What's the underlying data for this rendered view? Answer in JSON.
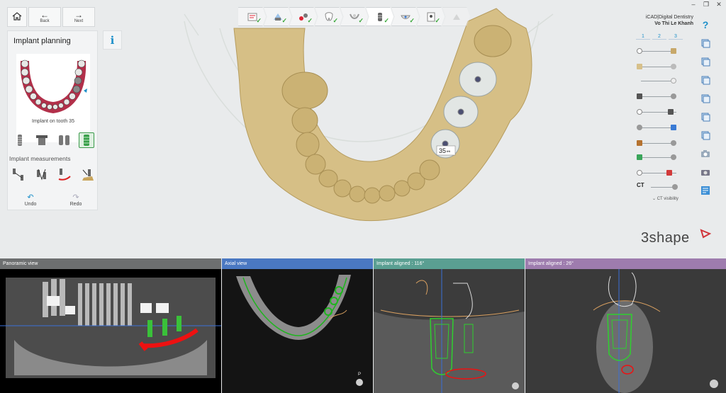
{
  "app": {
    "product": "iCAD|Digital Dentistry",
    "user": "Vo Thi Le Khanh",
    "brand": "3shape",
    "accent_color": "#1c8fc9"
  },
  "window_controls": [
    "minimize",
    "maximize",
    "close"
  ],
  "nav": {
    "home_icon": "home-icon",
    "back_label": "Back",
    "next_label": "Next"
  },
  "workflow_steps": [
    {
      "icon": "prescription-icon",
      "status": "done"
    },
    {
      "icon": "scan-icon",
      "status": "done"
    },
    {
      "icon": "tools-icon",
      "status": "done"
    },
    {
      "icon": "tooth-icon",
      "status": "done"
    },
    {
      "icon": "ct-segment-icon",
      "status": "done"
    },
    {
      "icon": "implant-icon",
      "status": "current"
    },
    {
      "icon": "guide-icon",
      "status": "done"
    },
    {
      "icon": "report-icon",
      "status": "done"
    },
    {
      "icon": "export-icon",
      "status": "disabled"
    }
  ],
  "left_panel": {
    "title": "Implant planning",
    "info_icon": "info-icon",
    "thumbnail_caption": "Implant on tooth 35",
    "tools": [
      "implant-tool-icon",
      "abutment-tool-icon",
      "multi-implant-tool-icon",
      "guided-sleeve-tool-icon"
    ],
    "active_tool_index": 3,
    "measurements_label": "Implant measurements",
    "measurement_tools": [
      "distance-measure-icon",
      "angle-measure-icon",
      "nerve-distance-icon",
      "bone-measure-icon"
    ],
    "undo_label": "Undo",
    "redo_label": "Redo"
  },
  "viewport": {
    "implant_label": "35",
    "arch_color": "#d8c28b",
    "crown_color": "#e3e6e5"
  },
  "visibility": {
    "layer_tabs": [
      "1",
      "2",
      "3"
    ],
    "ct_label": "CT",
    "ct_visibility_label": "CT visibility"
  },
  "right_toolbar": [
    "help-icon",
    "view-icon",
    "view-icon",
    "view-icon",
    "view-icon",
    "view-icon",
    "view-icon",
    "camera-icon",
    "screenshot-icon",
    "note-icon"
  ],
  "panes": {
    "panoramic": {
      "title": "Panoramic view",
      "header_color": "#6d6f70"
    },
    "axial": {
      "title": "Axial view",
      "header_color": "#4a78c2"
    },
    "implant1": {
      "title": "Implant aligned : 116°",
      "header_color": "#5a9f92"
    },
    "implant2": {
      "title": "Implant aligned : 26°",
      "header_color": "#9e7cae"
    }
  }
}
